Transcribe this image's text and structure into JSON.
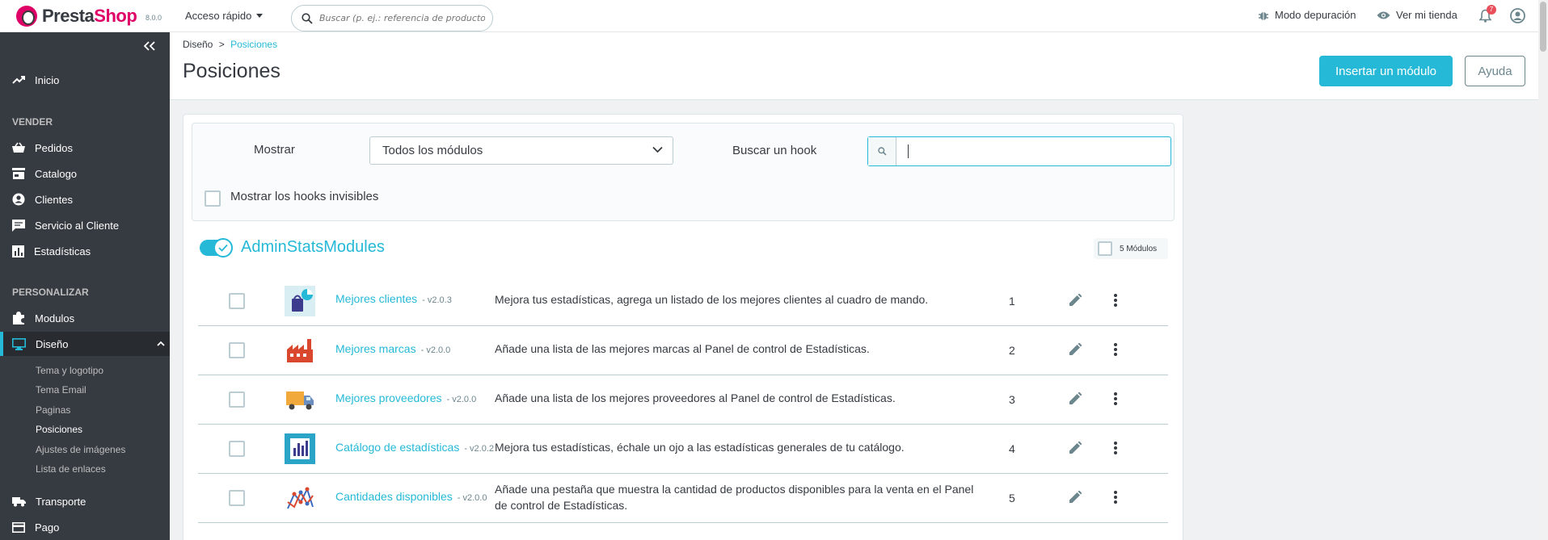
{
  "header": {
    "logo_prefix": "Presta",
    "logo_suffix": "Shop",
    "version": "8.0.0",
    "quick_access": "Acceso rápido",
    "search_placeholder": "Buscar (p. ej.: referencia de producto,",
    "debug_mode": "Modo depuración",
    "view_store": "Ver mi tienda",
    "notifications_count": "7"
  },
  "sidebar": {
    "home": "Inicio",
    "section_sell": "VENDER",
    "orders": "Pedidos",
    "catalog": "Catalogo",
    "customers": "Clientes",
    "customer_service": "Servicio al Cliente",
    "stats": "Estadísticas",
    "section_customize": "PERSONALIZAR",
    "modules": "Modulos",
    "design": "Diseño",
    "design_sub": [
      "Tema y logotipo",
      "Tema Email",
      "Paginas",
      "Posiciones",
      "Ajustes de imágenes",
      "Lista de enlaces"
    ],
    "shipping": "Transporte",
    "payment": "Pago"
  },
  "page": {
    "breadcrumb_parent": "Diseño",
    "breadcrumb_separator": ">",
    "breadcrumb_current": "Posiciones",
    "title": "Posiciones",
    "insert_module": "Insertar un módulo",
    "help": "Ayuda"
  },
  "filters": {
    "show_label": "Mostrar",
    "show_value": "Todos los módulos",
    "search_hook_label": "Buscar un hook",
    "show_invisible": "Mostrar los hooks invisibles"
  },
  "hook": {
    "name": "AdminStatsModules",
    "module_count": "5 Módulos",
    "modules": [
      {
        "name": "Mejores clientes",
        "version": "- v2.0.3",
        "description": "Mejora tus estadísticas, agrega un listado de los mejores clientes al cuadro de mando.",
        "position": "1"
      },
      {
        "name": "Mejores marcas",
        "version": "- v2.0.0",
        "description": "Añade una lista de las mejores marcas al Panel de control de Estadísticas.",
        "position": "2"
      },
      {
        "name": "Mejores proveedores",
        "version": "- v2.0.0",
        "description": "Añade una lista de los mejores proveedores al Panel de control de Estadísticas.",
        "position": "3"
      },
      {
        "name": "Catálogo de estadísticas",
        "version": "- v2.0.2",
        "description": "Mejora tus estadísticas, échale un ojo a las estadísticas generales de tu catálogo.",
        "position": "4"
      },
      {
        "name": "Cantidades disponibles",
        "version": "- v2.0.0",
        "description": "Añade una pestaña que muestra la cantidad de productos disponibles para la venta en el Panel de control de Estadísticas.",
        "position": "5"
      }
    ]
  }
}
